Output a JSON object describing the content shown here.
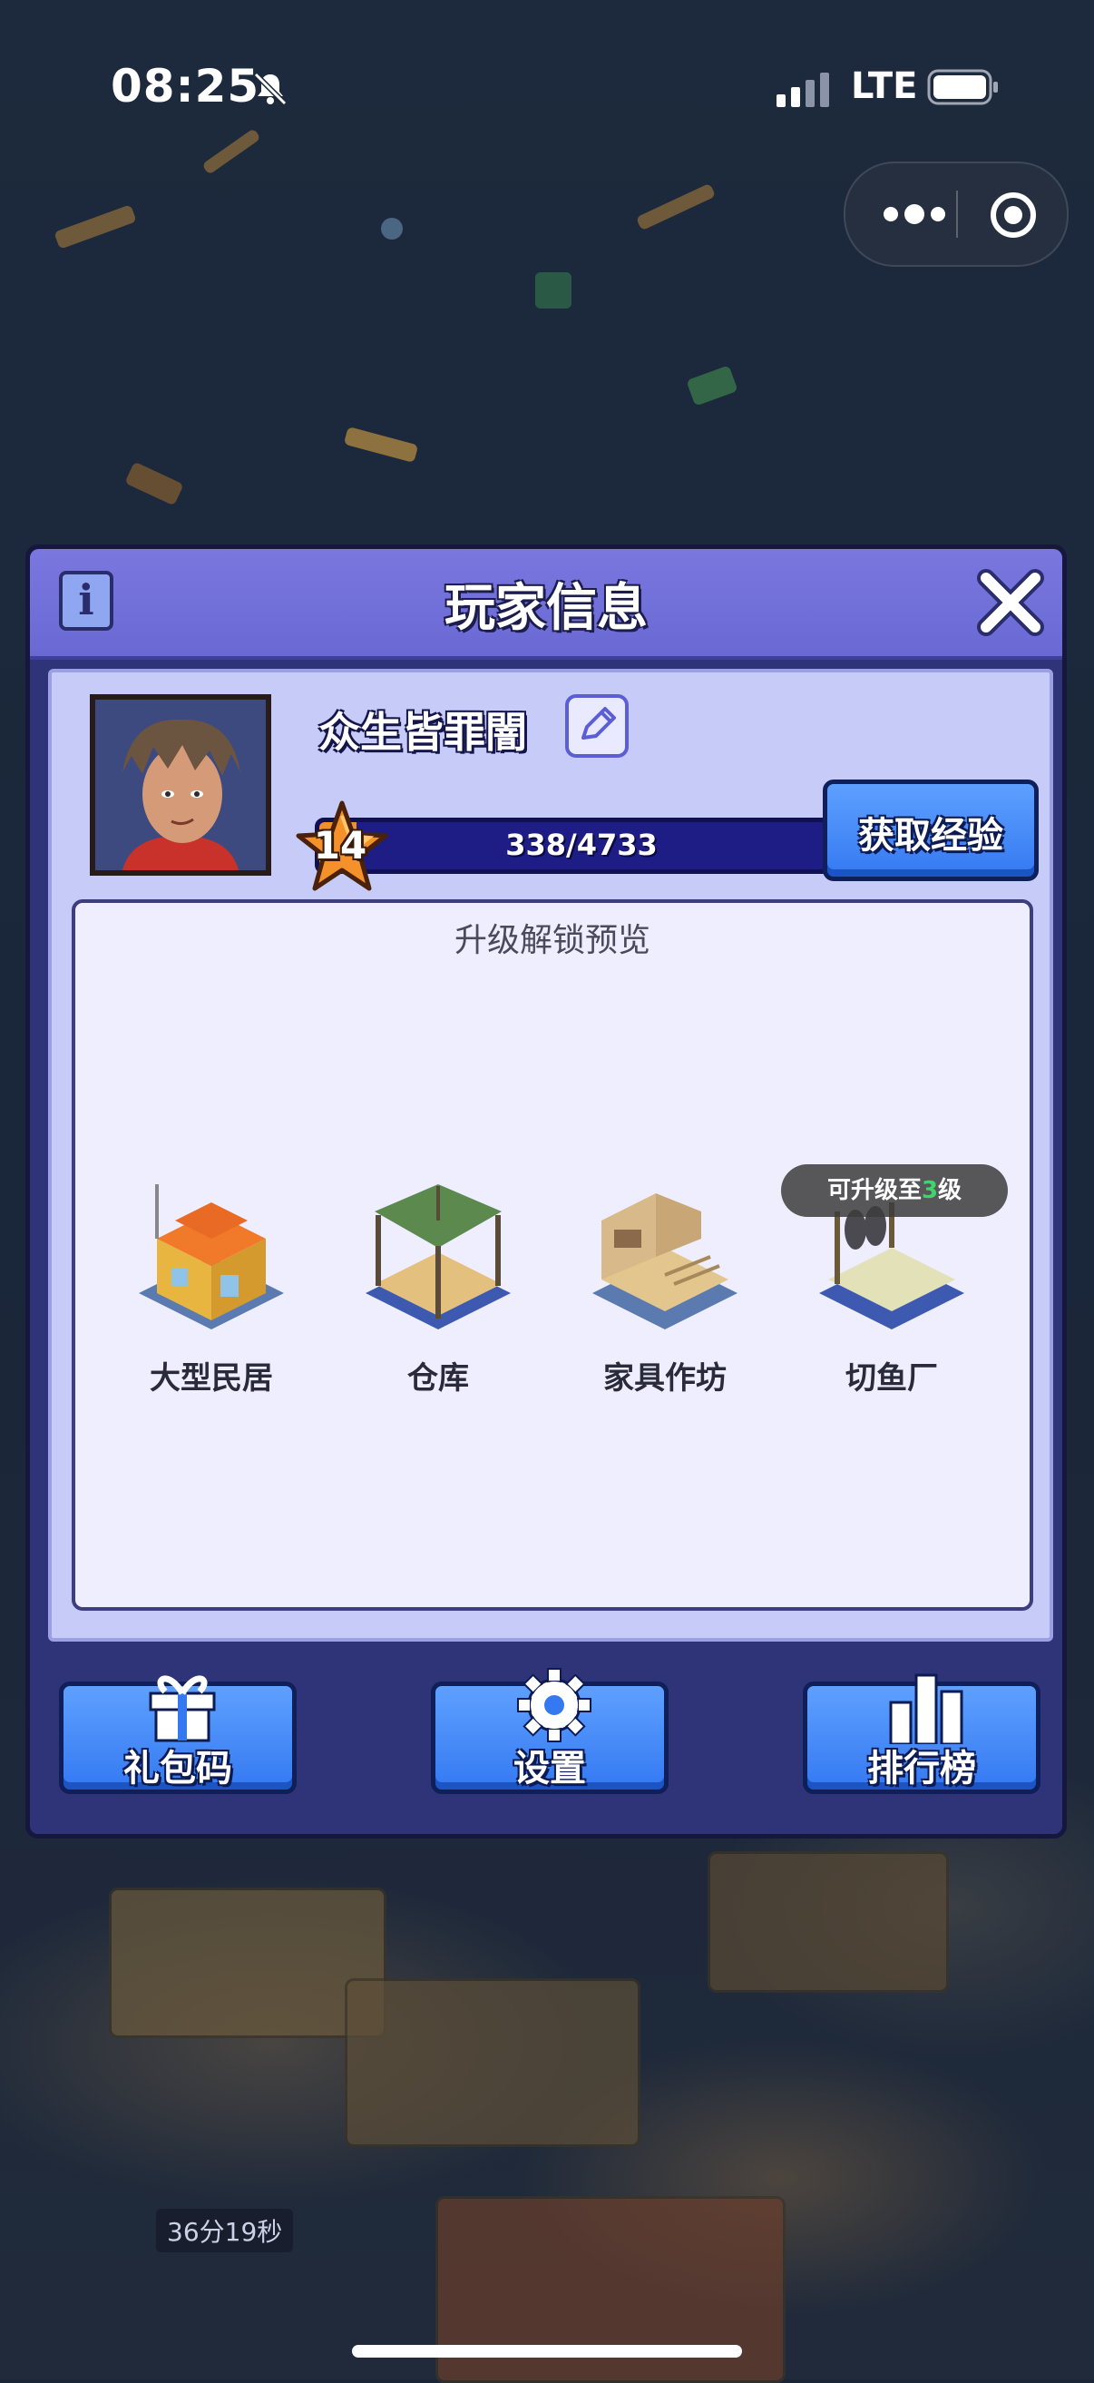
{
  "status_bar": {
    "time": "08:25",
    "network": "LTE"
  },
  "dialog": {
    "title": "玩家信息",
    "player": {
      "name": "众生皆罪闇",
      "level": "14",
      "xp_text": "338/4733",
      "xp_fraction": 0.0714
    },
    "get_exp_label": "获取经验",
    "preview": {
      "title": "升级解锁预览",
      "buildings": [
        {
          "name": "大型民居"
        },
        {
          "name": "仓库"
        },
        {
          "name": "家具作坊"
        },
        {
          "name": "切鱼厂"
        }
      ],
      "badge_prefix": "可升级至",
      "badge_level": "3",
      "badge_suffix": "级"
    },
    "buttons": {
      "gift_code": "礼包码",
      "settings": "设置",
      "leaderboard": "排行榜"
    }
  },
  "background": {
    "timer": "36分19秒"
  },
  "colors": {
    "accent_blue": "#3479f2",
    "header_purple": "#7a78df",
    "xp_orange": "#f0902a"
  }
}
